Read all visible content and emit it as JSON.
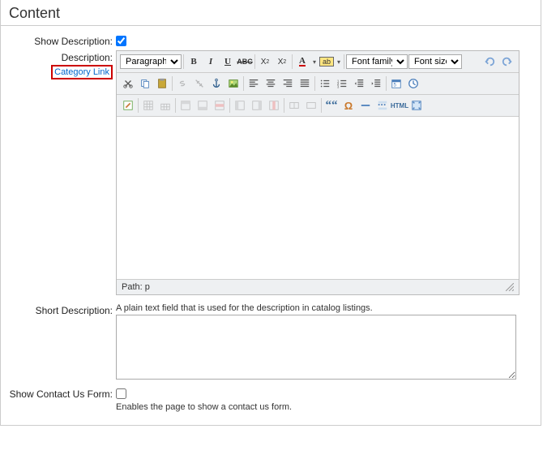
{
  "header": "Content",
  "labels": {
    "show_description": "Show Description:",
    "description": "Description:",
    "short_description": "Short Description:",
    "show_contact": "Show Contact Us Form:"
  },
  "category_link": "Category Link",
  "editor": {
    "paragraph_select": "Paragraph",
    "font_family": "Font family",
    "font_size": "Font size",
    "path": "Path: p"
  },
  "short_desc_help": "A plain text field that is used for the description in catalog listings.",
  "contact_help": "Enables the page to show a contact us form.",
  "values": {
    "show_description_checked": true,
    "short_description": "",
    "show_contact_checked": false
  }
}
